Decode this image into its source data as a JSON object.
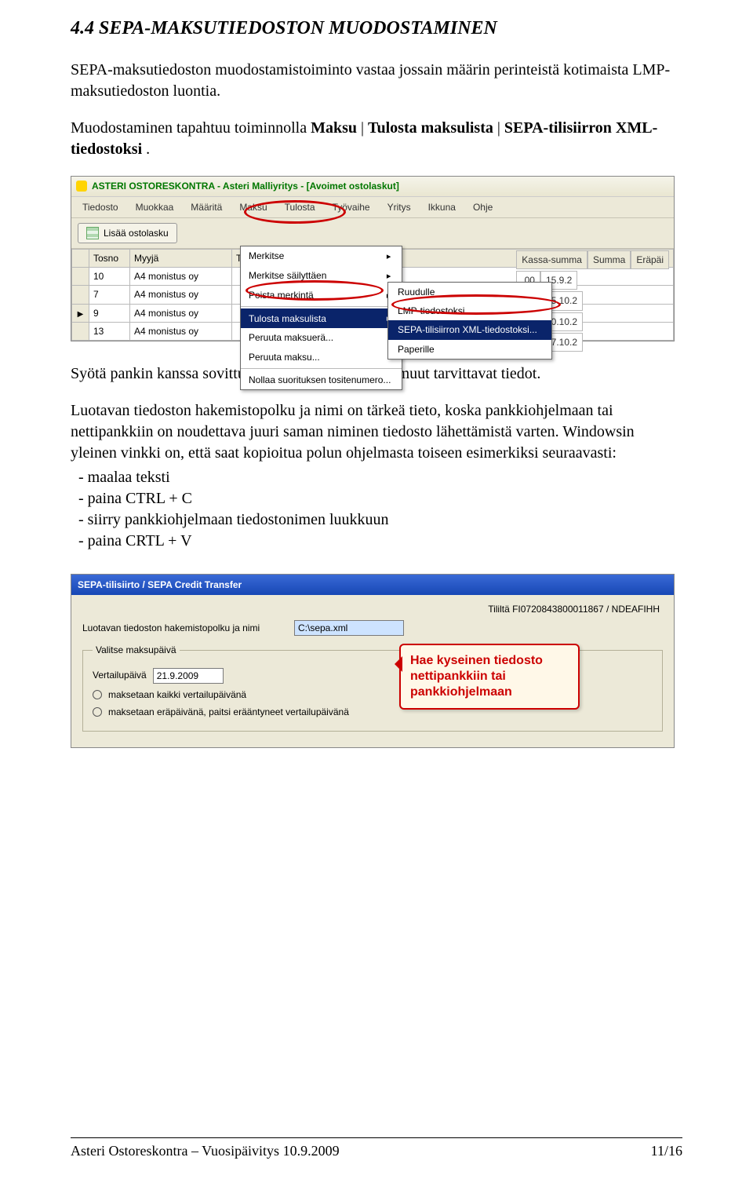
{
  "heading": "4.4 SEPA-MAKSUTIEDOSTON MUODOSTAMINEN",
  "intro": "SEPA-maksutiedoston muodostamistoiminto vastaa jossain määrin perinteistä kotimaista LMP-maksutiedoston luontia.",
  "menu_path": {
    "prefix": "Muodostaminen tapahtuu toiminnolla ",
    "b1": "Maksu",
    "sep": " | ",
    "b2": "Tulosta maksulista",
    "b3": "SEPA-tilisiirron XML-tiedostoksi",
    "end": "."
  },
  "shot1": {
    "title": "ASTERI OSTORESKONTRA - Asteri Malliyritys - [Avoimet ostolaskut]",
    "menubar": [
      "Tiedosto",
      "Muokkaa",
      "Määritä",
      "Maksu",
      "Tulosta",
      "Työvaihe",
      "Yritys",
      "Ikkuna",
      "Ohje"
    ],
    "toolbar_btn": "Lisää ostolasku",
    "col_headers": [
      "Tosno",
      "Myyjä",
      "T"
    ],
    "side_hdr1": "Summa",
    "side_hdr2": "Eräpäi",
    "side_pre": ",00",
    "rows": [
      [
        "10",
        "A4 monistus oy",
        "",
        "15.9.2"
      ],
      [
        "7",
        "A4 monistus oy",
        "",
        "15.10.2"
      ],
      [
        "9",
        "A4 monistus oy",
        "",
        "30.10.2"
      ],
      [
        "13",
        "A4 monistus oy",
        "",
        "17.10.2"
      ]
    ],
    "popup1": [
      {
        "label": "Merkitse"
      },
      {
        "label": "Merkitse säilyttäen"
      },
      {
        "label": "Poista merkintä"
      },
      {
        "label": "Tulosta maksulista",
        "hl": true,
        "arrow": true
      },
      {
        "label": "Peruuta maksuerä..."
      },
      {
        "label": "Peruuta maksu..."
      },
      {
        "label": "Nollaa suorituksen tositenumero..."
      }
    ],
    "popup2": [
      {
        "label": "Ruudulle"
      },
      {
        "label": "LMP-tiedostoksi..."
      },
      {
        "label": "SEPA-tilisiirron XML-tiedostoksi...",
        "hl": true
      },
      {
        "label": "Paperille"
      }
    ],
    "side_head_extra": "Kassa-summa"
  },
  "para2": "Syötä pankin kanssa sovittu maksupalvelutunnus ja muut tarvittavat tiedot.",
  "para3": "Luotavan tiedoston hakemistopolku ja nimi on tärkeä tieto, koska pankkiohjelmaan tai nettipankkiin on noudettava juuri saman niminen tiedosto lähettämistä varten. Windowsin yleinen vinkki on, että saat kopioitua polun ohjelmasta toiseen esimerkiksi seuraavasti:",
  "bullets": [
    "maalaa teksti",
    "paina CTRL + C",
    "siirry pankkiohjelmaan tiedostonimen luukkuun",
    "paina CRTL + V"
  ],
  "shot2": {
    "title": "SEPA-tilisiirto / SEPA Credit Transfer",
    "account_label": "Tililtä FI0720843800011867 / NDEAFIHH",
    "path_label": "Luotavan tiedoston hakemistopolku ja nimi",
    "path_value": "C:\\sepa.xml",
    "group": "Valitse maksupäivä",
    "vp_label": "Vertailupäivä",
    "vp_value": "21.9.2009",
    "r1": "maksetaan kaikki vertailupäivänä",
    "r2": "maksetaan eräpäivänä, paitsi erääntyneet vertailupäivänä",
    "callout": "Hae kyseinen tiedosto nettipankkiin tai pankkiohjelmaan"
  },
  "footer_left": "Asteri Ostoreskontra – Vuosipäivitys 10.9.2009",
  "footer_right": "11/16"
}
